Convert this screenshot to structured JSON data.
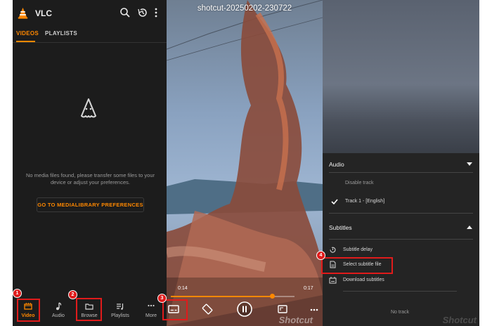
{
  "library": {
    "app_title": "VLC",
    "tabs": [
      {
        "label": "VIDEOS",
        "active": true
      },
      {
        "label": "PLAYLISTS",
        "active": false
      }
    ],
    "empty_message": "No media files found, please transfer some files to your device or adjust your preferences.",
    "pref_button": "GO TO MEDIALIBRARY PREFERENCES",
    "nav": [
      {
        "label": "Video",
        "icon": "video-icon",
        "active": true
      },
      {
        "label": "Audio",
        "icon": "music-note-icon",
        "active": false
      },
      {
        "label": "Browse",
        "icon": "folder-icon",
        "active": false
      },
      {
        "label": "Playlists",
        "icon": "playlist-icon",
        "active": false
      },
      {
        "label": "More",
        "icon": "more-dots-icon",
        "active": false
      }
    ],
    "accent": "#ff8800"
  },
  "player": {
    "title": "shotcut-20250202-230722",
    "time_elapsed": "0:14",
    "time_total": "0:17",
    "progress": 0.82,
    "watermark": "Shotcut"
  },
  "tracks": {
    "audio_header": "Audio",
    "audio_options": [
      "Disable track",
      "Track 1 - [English]"
    ],
    "selected_audio": "Track 1 - [English]",
    "subtitles_header": "Subtitles",
    "subtitle_options": [
      "Subtitle delay",
      "Select subtitle file",
      "Download subtitles"
    ],
    "no_track": "No track",
    "watermark": "Shotcut"
  },
  "steps": [
    "1",
    "2",
    "3",
    "4"
  ],
  "annotation_color": "#e01b1b"
}
